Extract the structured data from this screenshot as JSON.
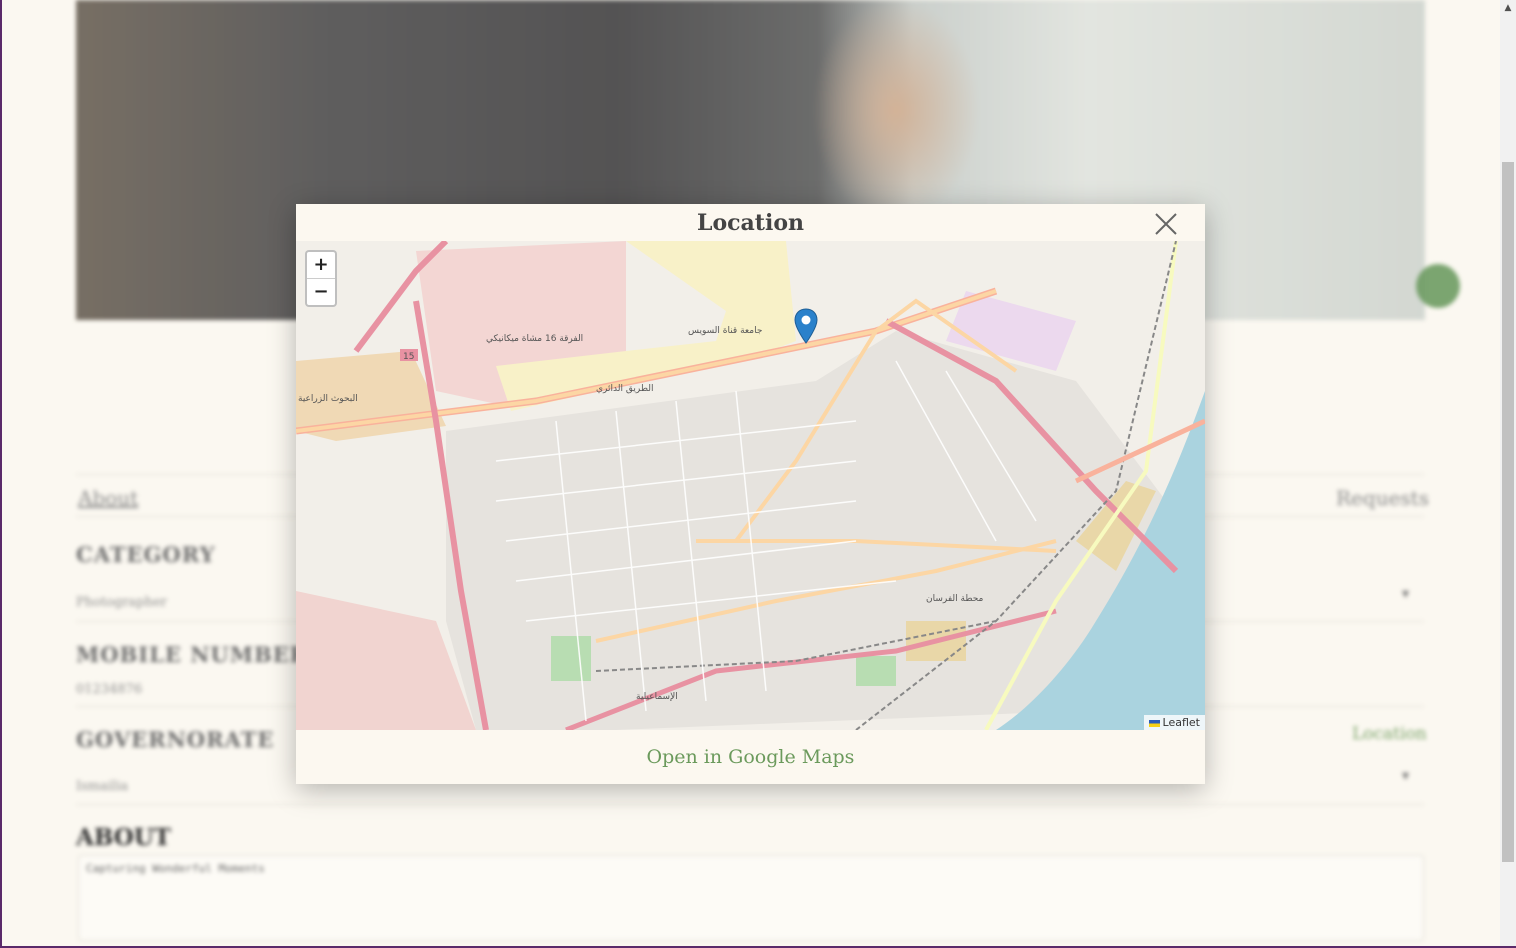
{
  "modal": {
    "title": "Location",
    "open_maps_label": "Open in Google Maps",
    "zoom_in": "+",
    "zoom_out": "−",
    "attribution": "Leaflet",
    "map_labels": {
      "university": "جامعة قناة السويس",
      "division": "الفرقة 16 مشاة ميكانيكي",
      "ring_road": "الطريق الدائري",
      "station": "محطة الفرسان",
      "ismailia": "الإسماعيلية",
      "route_15": "15",
      "research": "البحوث الزراعية"
    }
  },
  "page": {
    "tabs": {
      "about": "About",
      "requests": "Requests"
    },
    "fields": [
      {
        "label": "CATEGORY",
        "value": "Photographer"
      },
      {
        "label": "MOBILE NUMBER",
        "value": "01234876"
      },
      {
        "label": "GOVERNORATE",
        "value": "Ismailia"
      }
    ],
    "location_link": "Location",
    "about_heading": "ABOUT",
    "about_text": "Capturing Wonderful Moments"
  },
  "colors": {
    "accent_green": "#6b9a5c",
    "background": "#fbf8f1"
  }
}
